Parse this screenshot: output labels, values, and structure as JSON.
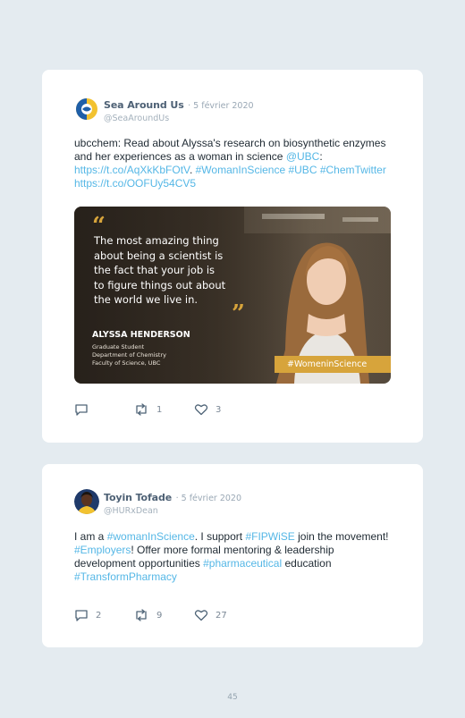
{
  "tweets": [
    {
      "author": "Sea Around Us",
      "date": "· 5 février 2020",
      "handle": "@SeaAroundUs",
      "avatar_icon": "sea-around-us-logo-icon",
      "text": {
        "t1": "ubcchem: Read about Alyssa's research on biosynthetic enzymes and her experiences as a woman in science ",
        "l1": "@UBC",
        "t2": ": ",
        "l2": "https://t.co/AqXkKbFOtV",
        "t3": ". ",
        "l3": "#WomanInScience",
        "t4": " ",
        "l4": "#UBC",
        "t5": " ",
        "l5": "#ChemTwitter",
        "t6": " ",
        "l6": "https://t.co/OOFUy54CV5"
      },
      "media": {
        "quote": "The most amazing thing about being a scientist is the fact that your job is to figure things out about the world we live in.",
        "quote_lines": [
          "The most amazing thing",
          "about being a scientist is",
          "the fact that your job is",
          "to figure things out about",
          "the world we live in."
        ],
        "name": "ALYSSA HENDERSON",
        "role_lines": [
          "Graduate Student",
          "Department of Chemistry",
          "Faculty of Science, UBC"
        ],
        "hashtag": "#WomeninScience"
      },
      "actions": {
        "replies": "",
        "retweets": "1",
        "likes": "3"
      }
    },
    {
      "author": "Toyin Tofade",
      "date": "· 5 février 2020",
      "handle": "@HURxDean",
      "avatar_icon": "profile-photo-icon",
      "text": {
        "t1": "I am a ",
        "l1": "#womanInScience",
        "t2": ". I support ",
        "l2": "#FIPWiSE",
        "t3": " join the movement! ",
        "l3": "#Employers",
        "t4": "! Offer more formal mentoring & leadership development opportunities ",
        "l4": "#pharmaceutical",
        "t5": " education ",
        "l5": "#TransformPharmacy"
      },
      "actions": {
        "replies": "2",
        "retweets": "9",
        "likes": "27"
      }
    }
  ],
  "page_number": "45",
  "colors": {
    "background": "#e4ebf0",
    "card": "#ffffff",
    "link": "#55b7e6",
    "name": "#4e6175",
    "banner": "#d7a43b"
  }
}
